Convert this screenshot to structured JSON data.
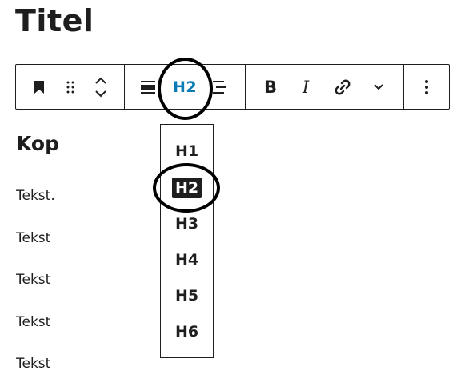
{
  "page": {
    "title": "Titel"
  },
  "toolbar": {
    "active_level": "H2",
    "bold_label": "B",
    "italic_label": "I",
    "icons": [
      "bookmark-icon",
      "drag-handle-icon",
      "move-up-icon",
      "move-down-icon",
      "align-icon",
      "text-align-icon",
      "link-icon",
      "chevron-down-icon",
      "more-options-icon"
    ]
  },
  "content": {
    "heading": "Kop",
    "paragraphs": [
      "Tekst.",
      "Tekst",
      "Tekst",
      "Tekst",
      "Tekst"
    ]
  },
  "heading_menu": {
    "items": [
      "H1",
      "H2",
      "H3",
      "H4",
      "H5",
      "H6"
    ],
    "selected": "H2"
  },
  "colors": {
    "accent": "#0a7bb5",
    "text": "#1e1e1e",
    "highlight_ring": "#000000"
  }
}
